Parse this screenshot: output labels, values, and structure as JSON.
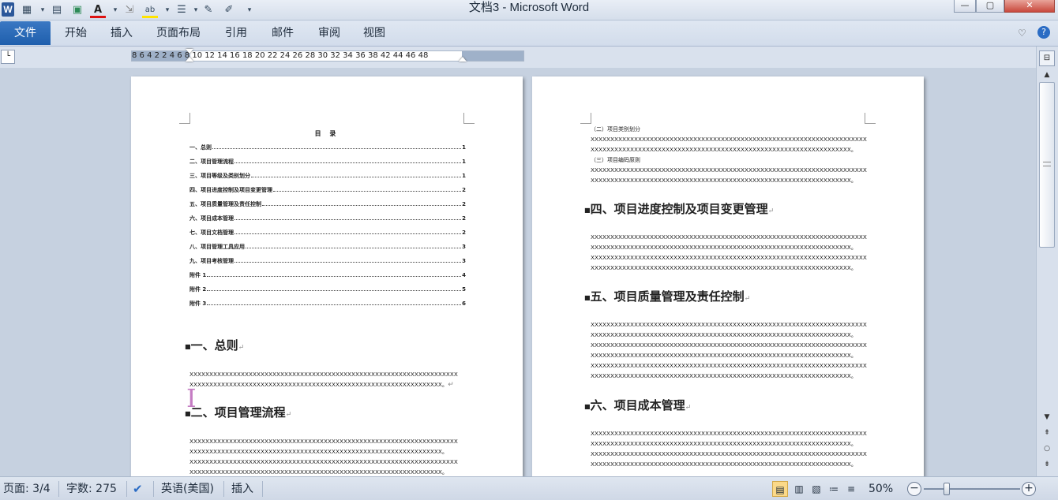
{
  "window": {
    "title": "文档3 - Microsoft Word",
    "app_icon": "W",
    "buttons": [
      "minimize",
      "maximize",
      "close"
    ]
  },
  "quick_access": [
    "table-icon",
    "form-icon",
    "image-icon",
    "font-color-icon",
    "dropdown-icon",
    "merge-icon",
    "highlight-icon",
    "dropdown-icon",
    "line-spacing-icon",
    "edit-icon",
    "edit-icon",
    "dropdown-icon"
  ],
  "ribbon": {
    "file_tab": "文件",
    "tabs": [
      "开始",
      "插入",
      "页面布局",
      "引用",
      "邮件",
      "审阅",
      "视图"
    ]
  },
  "ruler": {
    "numbers": "8  6  4  2     2  4  6  8  10 12 14 16 18 20 22 24 26 28 30 32 34 36 38    42 44 46 48"
  },
  "left_page": {
    "toc_title": "目  录",
    "toc": [
      {
        "title": "一、总则",
        "page": "1"
      },
      {
        "title": "二、项目管理流程",
        "page": "1"
      },
      {
        "title": "三、项目等级及类别划分",
        "page": "1"
      },
      {
        "title": "四、项目进度控制及项目变更管理",
        "page": "2"
      },
      {
        "title": "五、项目质量管理及责任控制",
        "page": "2"
      },
      {
        "title": "六、项目成本管理",
        "page": "2"
      },
      {
        "title": "七、项目文档管理",
        "page": "2"
      },
      {
        "title": "八、项目管理工具应用",
        "page": "3"
      },
      {
        "title": "九、项目考核管理",
        "page": "3"
      },
      {
        "title": "附件 1",
        "page": "4"
      },
      {
        "title": "附件 2",
        "page": "5"
      },
      {
        "title": "附件 3",
        "page": "6"
      }
    ],
    "headings": [
      "一、总则",
      "二、项目管理流程"
    ],
    "x_full": "XXXXXXXXXXXXXXXXXXXXXXXXXXXXXXXXXXXXXXXXXXXXXXXXXXXXXXXXXXXXXXXXXXXX",
    "x_end": "XXXXXXXXXXXXXXXXXXXXXXXXXXXXXXXXXXXXXXXXXXXXXXXXXXXXXXXXXXXXXXXX。"
  },
  "right_page": {
    "subheads": [
      "（二）项目类别划分",
      "（三）项目编码原则"
    ],
    "headings": [
      "四、项目进度控制及项目变更管理",
      "五、项目质量管理及责任控制",
      "六、项目成本管理"
    ],
    "x_full": "XXXXXXXXXXXXXXXXXXXXXXXXXXXXXXXXXXXXXXXXXXXXXXXXXXXXXXXXXXXXXXXXXXXXXX",
    "x_end": "XXXXXXXXXXXXXXXXXXXXXXXXXXXXXXXXXXXXXXXXXXXXXXXXXXXXXXXXXXXXXXXXXX。"
  },
  "status": {
    "page": "页面: 3/4",
    "words": "字数: 275",
    "language": "英语(美国)",
    "mode": "插入",
    "zoom": "50%",
    "zoom_level": 50,
    "icons": [
      "proofing-icon",
      "print-layout-icon",
      "full-screen-reading-icon",
      "web-layout-icon",
      "outline-icon",
      "draft-icon"
    ]
  },
  "colors": {
    "file_tab": "#1f5fad",
    "cursor": "#c57cc3",
    "active_view": "#fbd989"
  }
}
